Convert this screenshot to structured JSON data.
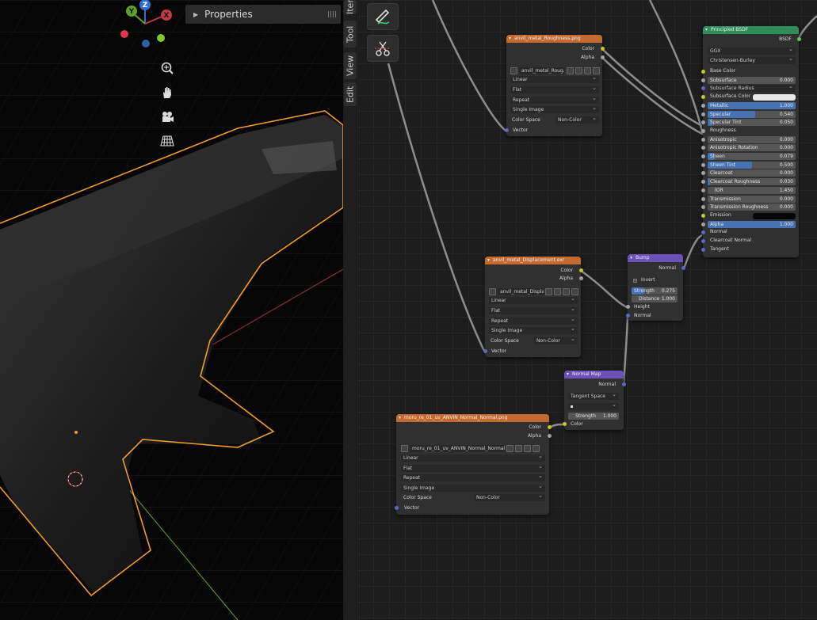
{
  "viewport": {
    "properties_label": "Properties",
    "gizmo": {
      "y": "Y",
      "z": "Z",
      "x": "X"
    },
    "tools": [
      "zoom-icon",
      "hand-icon",
      "camera-icon",
      "grid-icon"
    ]
  },
  "sidetabs": [
    "Item",
    "Tool",
    "View",
    "Edit"
  ],
  "toolbar": [
    "annotate-icon",
    "cut-links-icon"
  ],
  "nodes": {
    "roughness": {
      "title": "anvil_metal_Roughness.png",
      "out_color": "Color",
      "out_alpha": "Alpha",
      "image": "anvil_metal_Roug...",
      "interp": "Linear",
      "proj": "Flat",
      "ext": "Repeat",
      "src": "Single Image",
      "cs_label": "Color Space",
      "cs_value": "Non-Color",
      "in_vector": "Vector"
    },
    "displacement": {
      "title": "anvil_metal_Displacement.exr",
      "out_color": "Color",
      "out_alpha": "Alpha",
      "image": "anvil_metal_Displa...",
      "interp": "Linear",
      "proj": "Flat",
      "ext": "Repeat",
      "src": "Single Image",
      "cs_label": "Color Space",
      "cs_value": "Non-Color",
      "in_vector": "Vector"
    },
    "normal_tex": {
      "title": "moru_re_01_uv_ANVIN_Normal_Normal.png",
      "out_color": "Color",
      "out_alpha": "Alpha",
      "image": "moru_re_01_uv_ANVIN_Normal_Normal.png",
      "interp": "Linear",
      "proj": "Flat",
      "ext": "Repeat",
      "src": "Single Image",
      "cs_label": "Color Space",
      "cs_value": "Non-Color",
      "in_vector": "Vector"
    },
    "bump": {
      "title": "Bump",
      "out_normal": "Normal",
      "invert": "Invert",
      "strength_label": "Strength",
      "strength": "0.275",
      "distance_label": "Distance",
      "distance": "1.000",
      "height": "Height",
      "normal": "Normal"
    },
    "normal_map": {
      "title": "Normal Map",
      "out_normal": "Normal",
      "space": "Tangent Space",
      "strength_label": "Strength",
      "strength": "1.000",
      "color": "Color"
    },
    "bsdf": {
      "title": "Principled BSDF",
      "out": "BSDF",
      "distribution": "GGX",
      "sss_method": "Christensen-Burley",
      "rows": [
        {
          "label": "Base Color",
          "kind": "socket",
          "sock": "y"
        },
        {
          "label": "Subsurface",
          "kind": "field",
          "value": "0.000",
          "fill": 0,
          "sock": "g"
        },
        {
          "label": "Subsurface Radius",
          "kind": "dropdown",
          "sock": "p"
        },
        {
          "label": "Subsurface Color",
          "kind": "color",
          "color": "#e8e8e8",
          "sock": "y"
        },
        {
          "label": "Metallic",
          "kind": "field",
          "value": "1.000",
          "fill": 1,
          "sock": "g"
        },
        {
          "label": "Specular",
          "kind": "field",
          "value": "0.540",
          "fill": 0.54,
          "sock": "g"
        },
        {
          "label": "Specular Tint",
          "kind": "field",
          "value": "0.050",
          "fill": 0.05,
          "sock": "g"
        },
        {
          "label": "Roughness",
          "kind": "socket",
          "sock": "g"
        },
        {
          "label": "Anisotropic",
          "kind": "field",
          "value": "0.000",
          "fill": 0,
          "sock": "g"
        },
        {
          "label": "Anisotropic Rotation",
          "kind": "field",
          "value": "0.000",
          "fill": 0,
          "sock": "g"
        },
        {
          "label": "Sheen",
          "kind": "field",
          "value": "0.079",
          "fill": 0.079,
          "sock": "g"
        },
        {
          "label": "Sheen Tint",
          "kind": "field",
          "value": "0.500",
          "fill": 0.5,
          "sock": "g"
        },
        {
          "label": "Clearcoat",
          "kind": "field",
          "value": "0.000",
          "fill": 0,
          "sock": "g"
        },
        {
          "label": "Clearcoat Roughness",
          "kind": "field",
          "value": "0.030",
          "fill": 0.03,
          "sock": "g"
        },
        {
          "label": "IOR",
          "kind": "field",
          "value": "1.450",
          "fill": 0,
          "sock": "g"
        },
        {
          "label": "Transmission",
          "kind": "field",
          "value": "0.000",
          "fill": 0,
          "sock": "g"
        },
        {
          "label": "Transmission Roughness",
          "kind": "field",
          "value": "0.000",
          "fill": 0,
          "sock": "g"
        },
        {
          "label": "Emission",
          "kind": "color",
          "color": "#050505",
          "sock": "y"
        },
        {
          "label": "Alpha",
          "kind": "field",
          "value": "1.000",
          "fill": 1,
          "sock": "g"
        },
        {
          "label": "Normal",
          "kind": "socket",
          "sock": "p"
        },
        {
          "label": "Clearcoat Normal",
          "kind": "socket",
          "sock": "p"
        },
        {
          "label": "Tangent",
          "kind": "socket",
          "sock": "p"
        }
      ]
    }
  },
  "colors": {
    "selection": "#f29a2e",
    "texture_header": "#c46a30",
    "vector_header": "#6a52b8",
    "shader_header": "#2f8d5a"
  }
}
